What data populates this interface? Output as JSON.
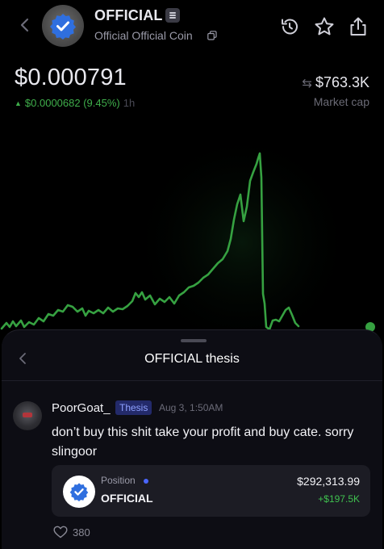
{
  "header": {
    "ticker": "OFFICIAL",
    "name": "Official Official Coin"
  },
  "price": {
    "value": "$0.000791",
    "change_text": "$0.0000682 (9.45%)",
    "timeframe": "1h",
    "change_direction_icon": "triangle-up-icon"
  },
  "market_cap": {
    "value": "$763.3K",
    "label": "Market cap"
  },
  "colors": {
    "background": "#000000",
    "chart_line": "#36a141",
    "positive": "#3fae4b",
    "sheet_bg": "#0d0d14",
    "thesis_badge_bg": "#232a6a",
    "thesis_badge_text": "#8ea0ff",
    "verified_blue": "#2f6fdf"
  },
  "chart": {
    "line_color": "#36a141",
    "live_dot_color": "#36a141"
  },
  "sheet": {
    "title": "OFFICIAL thesis"
  },
  "post": {
    "username": "PoorGoat_",
    "badge": "Thesis",
    "timestamp": "Aug 3, 1:50AM",
    "text": "don’t buy this shit take your profit and buy cate. sorry slingoor",
    "likes": "380"
  },
  "position": {
    "label": "Position",
    "ticker": "OFFICIAL",
    "value": "$292,313.99",
    "pnl": "+$197.5K"
  },
  "icons": [
    "back-chevron-icon",
    "verified-badge-icon",
    "menu-icon",
    "copy-icon",
    "history-icon",
    "star-icon",
    "share-icon",
    "swap-icon",
    "heart-icon"
  ]
}
